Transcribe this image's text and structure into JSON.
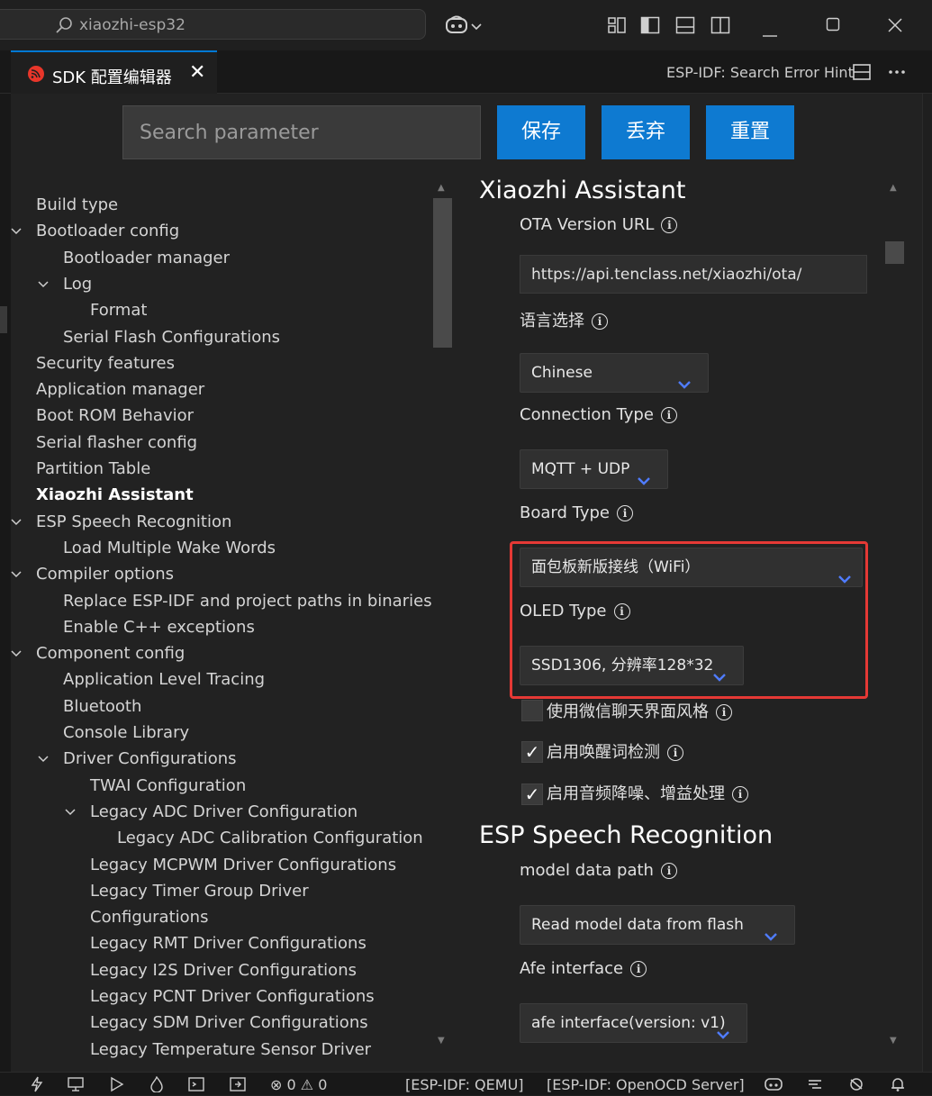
{
  "titlebar": {
    "search_text": "xiaozhi-esp32"
  },
  "tab": {
    "label": "SDK 配置编辑器",
    "close": "✕",
    "right_hint": "ESP-IDF: Search Error Hint"
  },
  "toolbar": {
    "search_placeholder": "Search parameter",
    "save": "保存",
    "discard": "丢弃",
    "reset": "重置"
  },
  "tree": [
    {
      "label": "Build type",
      "level": 0,
      "expanded": null
    },
    {
      "label": "Bootloader config",
      "level": 0,
      "expanded": true
    },
    {
      "label": "Bootloader manager",
      "level": 1,
      "expanded": null
    },
    {
      "label": "Log",
      "level": 1,
      "expanded": true
    },
    {
      "label": "Format",
      "level": 2,
      "expanded": null
    },
    {
      "label": "Serial Flash Configurations",
      "level": 1,
      "expanded": null
    },
    {
      "label": "Security features",
      "level": 0,
      "expanded": null
    },
    {
      "label": "Application manager",
      "level": 0,
      "expanded": null
    },
    {
      "label": "Boot ROM Behavior",
      "level": 0,
      "expanded": null
    },
    {
      "label": "Serial flasher config",
      "level": 0,
      "expanded": null
    },
    {
      "label": "Partition Table",
      "level": 0,
      "expanded": null
    },
    {
      "label": "Xiaozhi Assistant",
      "level": 0,
      "expanded": null,
      "selected": true
    },
    {
      "label": "ESP Speech Recognition",
      "level": 0,
      "expanded": true
    },
    {
      "label": "Load Multiple Wake Words",
      "level": 1,
      "expanded": null
    },
    {
      "label": "Compiler options",
      "level": 0,
      "expanded": true
    },
    {
      "label": "Replace ESP-IDF and project paths in binaries",
      "level": 1,
      "expanded": null
    },
    {
      "label": "Enable C++ exceptions",
      "level": 1,
      "expanded": null
    },
    {
      "label": "Component config",
      "level": 0,
      "expanded": true
    },
    {
      "label": "Application Level Tracing",
      "level": 1,
      "expanded": null
    },
    {
      "label": "Bluetooth",
      "level": 1,
      "expanded": null
    },
    {
      "label": "Console Library",
      "level": 1,
      "expanded": null
    },
    {
      "label": "Driver Configurations",
      "level": 1,
      "expanded": true
    },
    {
      "label": "TWAI Configuration",
      "level": 2,
      "expanded": null
    },
    {
      "label": "Legacy ADC Driver Configuration",
      "level": 2,
      "expanded": true
    },
    {
      "label": "Legacy ADC Calibration Configuration",
      "level": 3,
      "expanded": null
    },
    {
      "label": "Legacy MCPWM Driver Configurations",
      "level": 2,
      "expanded": null
    },
    {
      "label": "Legacy Timer Group Driver",
      "level": 2,
      "expanded": null
    },
    {
      "label": "Configurations",
      "level": 2,
      "expanded": null
    },
    {
      "label": "Legacy RMT Driver Configurations",
      "level": 2,
      "expanded": null
    },
    {
      "label": "Legacy I2S Driver Configurations",
      "level": 2,
      "expanded": null
    },
    {
      "label": "Legacy PCNT Driver Configurations",
      "level": 2,
      "expanded": null
    },
    {
      "label": "Legacy SDM Driver Configurations",
      "level": 2,
      "expanded": null
    },
    {
      "label": "Legacy Temperature Sensor Driver",
      "level": 2,
      "expanded": null
    }
  ],
  "panel": {
    "section1_title": "Xiaozhi Assistant",
    "ota_label": "OTA Version URL",
    "ota_value": "https://api.tenclass.net/xiaozhi/ota/",
    "language_label": "语言选择",
    "language_value": "Chinese",
    "connection_label": "Connection Type",
    "connection_value": "MQTT + UDP",
    "board_label": "Board Type",
    "board_value": "面包板新版接线（WiFi）",
    "oled_label": "OLED Type",
    "oled_value": "SSD1306, 分辨率128*32",
    "wechat_label": "使用微信聊天界面风格",
    "wechat_checked": false,
    "wake_label": "启用唤醒词检测",
    "wake_checked": true,
    "audio_label": "启用音频降噪、增益处理",
    "audio_checked": true,
    "section2_title": "ESP Speech Recognition",
    "model_label": "model data path",
    "model_value": "Read model data from flash",
    "afe_label": "Afe interface",
    "afe_value": "afe interface(version: v1)",
    "check_mark": "✓",
    "info_glyph": "i"
  },
  "statusbar": {
    "problems_errors": "0",
    "problems_warnings": "0",
    "qemu": "[ESP-IDF: QEMU]",
    "openocd": "[ESP-IDF: OpenOCD Server]"
  },
  "colors": {
    "accent_blue": "#0e7ad1",
    "highlight_red": "#e53935",
    "dropdown_chevron": "#4f7cff"
  }
}
